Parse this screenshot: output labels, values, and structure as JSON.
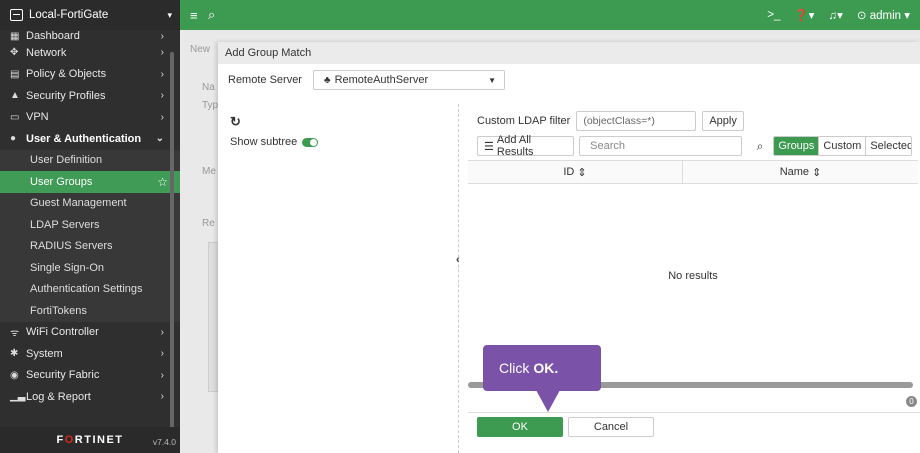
{
  "topbar": {
    "device_name": "Local-FortiGate",
    "admin_label": "admin"
  },
  "sidebar": {
    "items": [
      {
        "label": "Dashboard",
        "icon": "dashboard-icon"
      },
      {
        "label": "Network",
        "icon": "network-icon"
      },
      {
        "label": "Policy & Objects",
        "icon": "policy-icon"
      },
      {
        "label": "Security Profiles",
        "icon": "lock-icon"
      },
      {
        "label": "VPN",
        "icon": "vpn-icon"
      },
      {
        "label": "User & Authentication",
        "icon": "user-icon"
      }
    ],
    "sub_items": [
      {
        "label": "User Definition"
      },
      {
        "label": "User Groups"
      },
      {
        "label": "Guest Management"
      },
      {
        "label": "LDAP Servers"
      },
      {
        "label": "RADIUS Servers"
      },
      {
        "label": "Single Sign-On"
      },
      {
        "label": "Authentication Settings"
      },
      {
        "label": "FortiTokens"
      }
    ],
    "bottom_items": [
      {
        "label": "WiFi Controller",
        "icon": "wifi-icon"
      },
      {
        "label": "System",
        "icon": "gear-icon"
      },
      {
        "label": "Security Fabric",
        "icon": "fabric-icon"
      },
      {
        "label": "Log & Report",
        "icon": "chart-icon"
      }
    ],
    "logo_text": "FORTINET",
    "version": "v7.4.0"
  },
  "background": {
    "new_label": "New",
    "na_label": "Na",
    "type_label": "Typ",
    "me_label": "Me",
    "re_label": "Re"
  },
  "panel": {
    "title": "Add Group Match",
    "remote_server_label": "Remote Server",
    "remote_server_value": "RemoteAuthServer",
    "show_subtree_label": "Show subtree",
    "ldap_filter_label": "Custom LDAP filter",
    "ldap_filter_value": "(objectClass=*)",
    "apply_label": "Apply",
    "add_all_label": "Add All Results",
    "search_placeholder": "Search",
    "segments": [
      "Groups",
      "Custom",
      "Selected"
    ],
    "active_segment": "Groups",
    "columns": [
      "ID",
      "Name"
    ],
    "empty_text": "No results",
    "count_badge": "0",
    "ok_label": "OK",
    "cancel_label": "Cancel"
  },
  "callout": {
    "prefix": "Click",
    "emphasis": "OK."
  },
  "colors": {
    "accent_green": "#3d9a51",
    "sidebar_bg": "#2f2f2f",
    "callout_purple": "#7a52a8"
  }
}
